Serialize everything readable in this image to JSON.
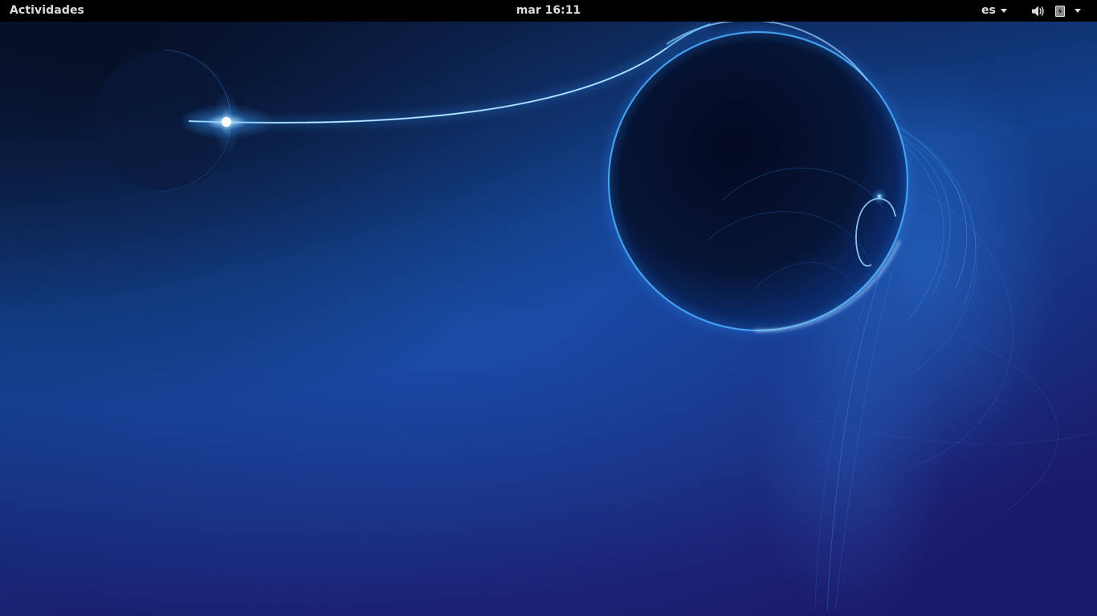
{
  "topbar": {
    "activities_label": "Actividades",
    "clock": "mar 16:11",
    "keyboard_layout": "es",
    "icons": {
      "volume": "volume-icon",
      "battery": "battery-icon",
      "system_menu": "chevron-down-icon"
    }
  },
  "wallpaper": {
    "colors": {
      "bg_top": "#0b1b3e",
      "bg_mid": "#123a86",
      "bg_bottom": "#1a1868",
      "glow": "#3fa2ff",
      "glow_core": "#e6f6ff"
    }
  }
}
